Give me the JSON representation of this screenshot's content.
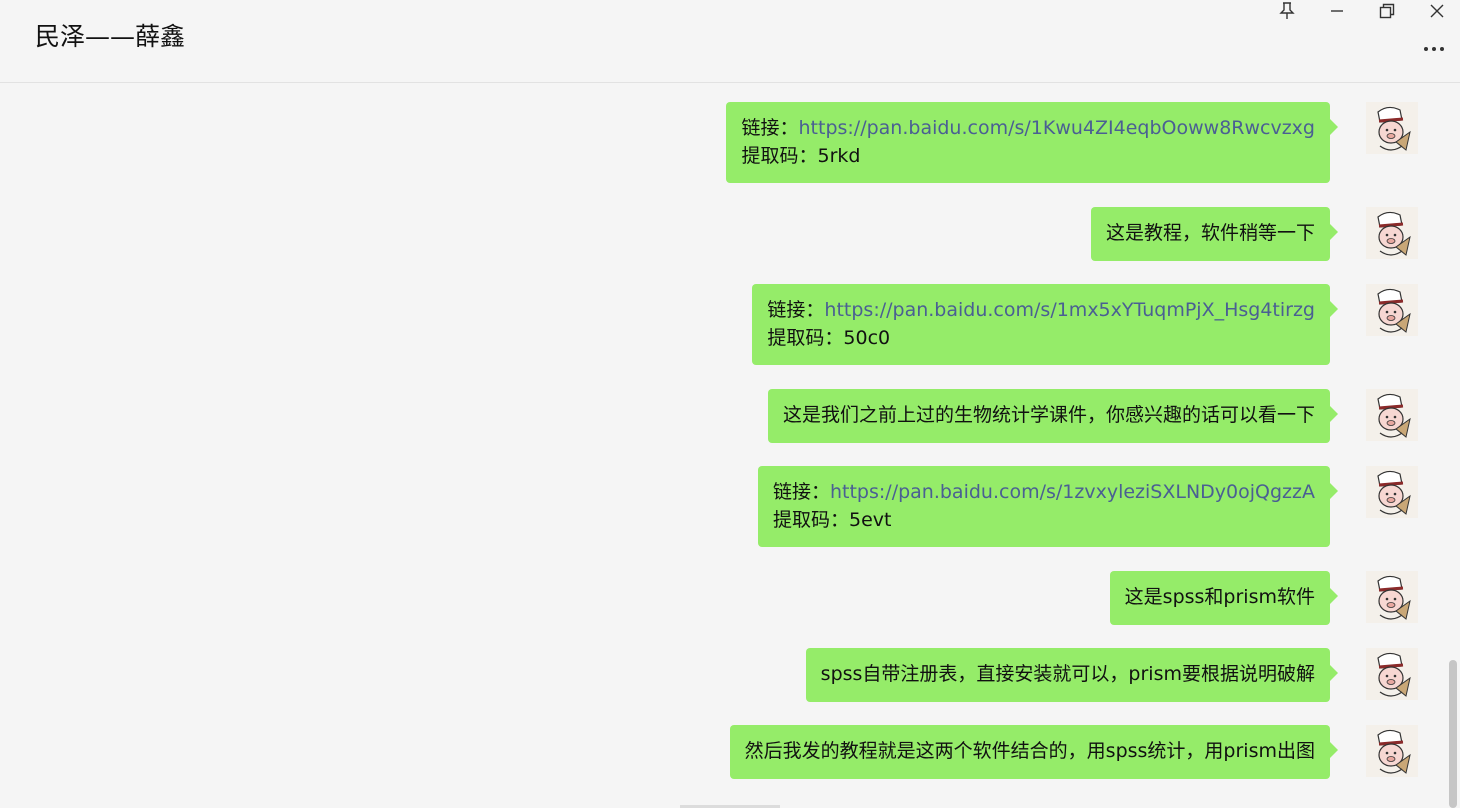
{
  "window": {
    "title": "民泽——薛鑫",
    "controls": {
      "pin": "pin-icon",
      "minimize": "minimize-icon",
      "restore": "restore-icon",
      "close": "close-icon",
      "more": "more-icon"
    }
  },
  "colors": {
    "bubble": "#95ec69",
    "link": "#4a5f93",
    "background": "#f5f5f5"
  },
  "messages": [
    {
      "link_label": "链接：",
      "url": "https://pan.baidu.com/s/1Kwu4ZI4eqbOoww8Rwcvzxg",
      "code_label": "提取码：",
      "code": "5rkd"
    },
    {
      "text": "这是教程，软件稍等一下"
    },
    {
      "link_label": "链接：",
      "url": "https://pan.baidu.com/s/1mx5xYTuqmPjX_Hsg4tirzg",
      "code_label": "提取码：",
      "code": "50c0"
    },
    {
      "text": "这是我们之前上过的生物统计学课件，你感兴趣的话可以看一下"
    },
    {
      "link_label": "链接：",
      "url": "https://pan.baidu.com/s/1zvxyleziSXLNDy0ojQgzzA",
      "code_label": "提取码：",
      "code": "5evt"
    },
    {
      "text": "这是spss和prism软件"
    },
    {
      "text": "spss自带注册表，直接安装就可以，prism要根据说明破解"
    },
    {
      "text": "然后我发的教程就是这两个软件结合的，用spss统计，用prism出图"
    }
  ]
}
